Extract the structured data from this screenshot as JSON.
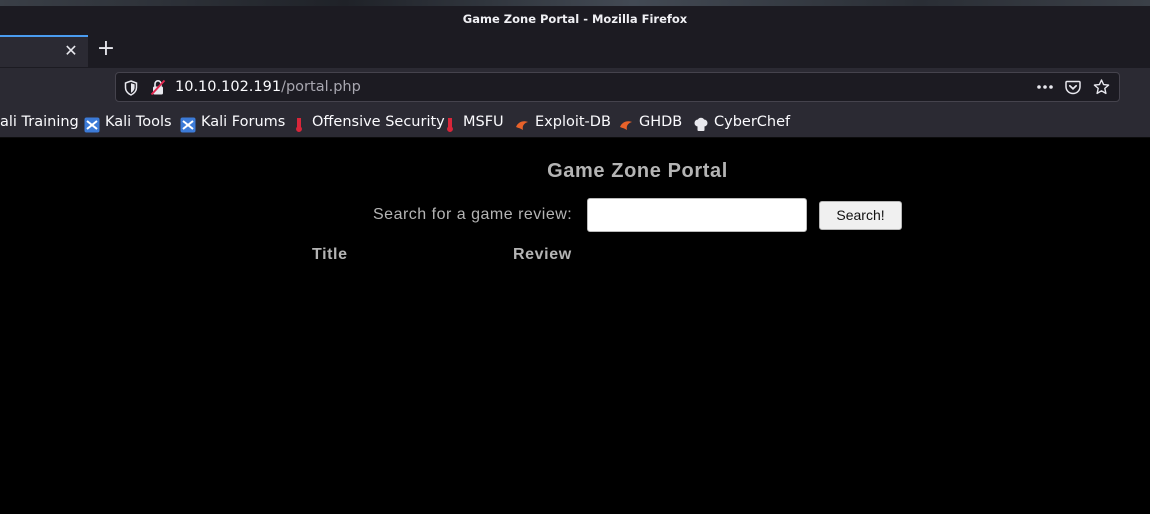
{
  "window": {
    "title": "Game Zone Portal - Mozilla Firefox"
  },
  "tabs": {
    "close_label": "✕",
    "new_tab_label": "+"
  },
  "urlbar": {
    "host": "10.10.102.191",
    "path": "/portal.php",
    "icons": [
      "shield-icon",
      "insecure-lock-icon",
      "page-actions-icon",
      "pocket-icon",
      "bookmark-star-icon"
    ]
  },
  "bookmarks": [
    {
      "label": "ali Training",
      "icon": "none"
    },
    {
      "label": "Kali Tools",
      "icon": "kali-icon"
    },
    {
      "label": "Kali Forums",
      "icon": "kali-icon"
    },
    {
      "label": "Offensive Security",
      "icon": "offsec-icon"
    },
    {
      "label": "MSFU",
      "icon": "offsec-icon"
    },
    {
      "label": "Exploit-DB",
      "icon": "exploitdb-icon"
    },
    {
      "label": "GHDB",
      "icon": "exploitdb-icon"
    },
    {
      "label": "CyberChef",
      "icon": "chef-hat-icon"
    }
  ],
  "page": {
    "title": "Game Zone Portal",
    "search_label": "Search for a game review:",
    "search_value": "",
    "search_button": "Search!",
    "columns": [
      "Title",
      "Review"
    ]
  },
  "colors": {
    "page_background": "#000000",
    "page_text": "#b4b4b4",
    "tab_accent": "#4a9cf0",
    "chrome_dark": "#1c1b22",
    "chrome_toolbar": "#2b2a33"
  }
}
